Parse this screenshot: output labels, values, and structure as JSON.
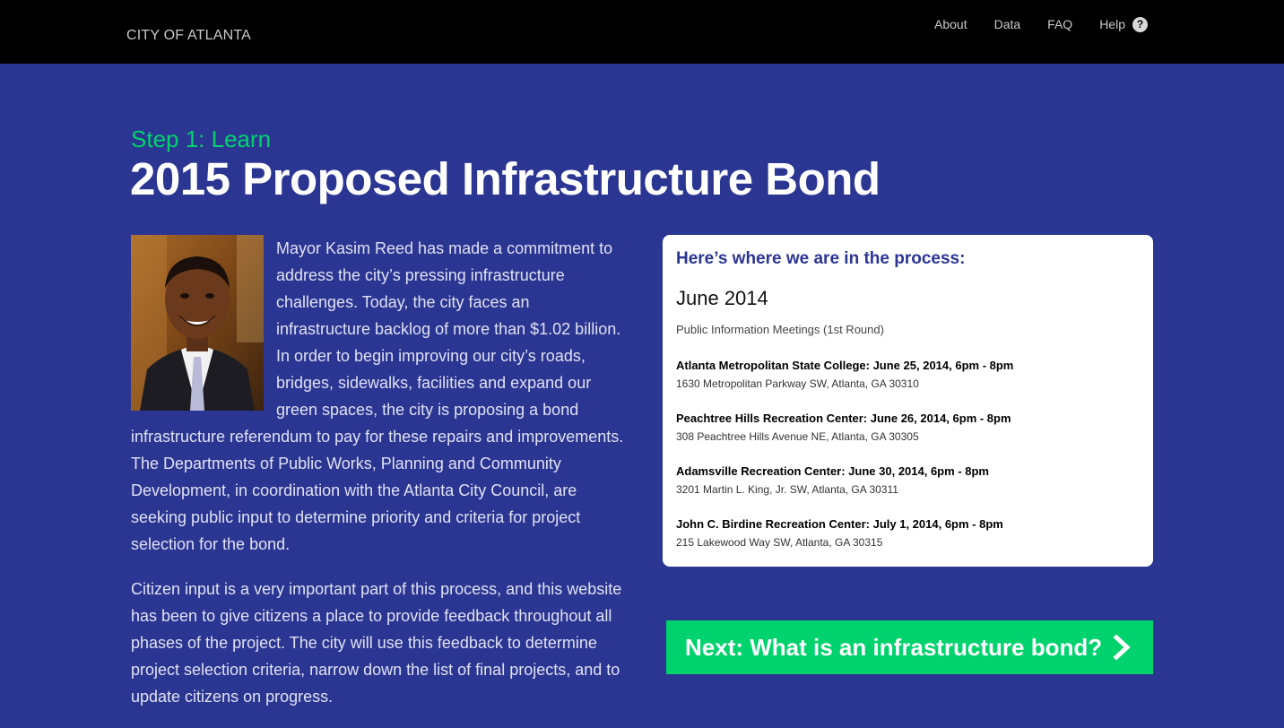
{
  "header": {
    "brand": "CITY OF ATLANTA",
    "nav": [
      {
        "label": "About"
      },
      {
        "label": "Data"
      },
      {
        "label": "FAQ"
      },
      {
        "label": "Help"
      }
    ],
    "help_icon_glyph": "?"
  },
  "hero": {
    "step": "Step 1: Learn",
    "title": "2015 Proposed Infrastructure Bond"
  },
  "intro": {
    "photo_alt": "Mayor Kasim Reed",
    "paragraphs": [
      "Mayor Kasim Reed has made a commitment to address the city’s pressing infrastructure challenges. Today, the city faces an infrastructure backlog of more than $1.02 billion. In order to begin improving our city’s roads, bridges, sidewalks, facilities and expand our green spaces, the city is proposing a bond infrastructure referendum to pay for these repairs and improvements. The Departments of Public Works, Planning and Community Development, in coordination with the Atlanta City Council, are seeking public input to determine priority and criteria for project selection for the bond.",
      "Citizen input is a very important part of this process, and this website has been to give citizens a place to provide feedback throughout all phases of the project. The city will use this feedback to determine project selection criteria, narrow down the list of final projects, and to update citizens on progress."
    ]
  },
  "process_card": {
    "heading": "Here’s where we are in the process:",
    "month": "June 2014",
    "subtitle": "Public Information Meetings (1st Round)",
    "events": [
      {
        "name": "Atlanta Metropolitan State College: June 25, 2014, 6pm - 8pm",
        "address": "1630 Metropolitan Parkway SW, Atlanta, GA 30310"
      },
      {
        "name": "Peachtree Hills Recreation Center: June 26, 2014, 6pm - 8pm",
        "address": "308 Peachtree Hills Avenue NE, Atlanta, GA 30305"
      },
      {
        "name": "Adamsville Recreation Center: June 30, 2014, 6pm - 8pm",
        "address": "3201 Martin L. King, Jr. SW, Atlanta, GA 30311"
      },
      {
        "name": "John C. Birdine Recreation Center: July 1, 2014, 6pm - 8pm",
        "address": "215 Lakewood Way SW, Atlanta, GA 30315"
      }
    ]
  },
  "next_button": {
    "label": "Next: What is an infrastructure bond?",
    "icon": "chevron-right-icon"
  },
  "colors": {
    "page_background": "#2b3592",
    "topbar": "#000000",
    "accent_green": "#00d36d",
    "card_heading": "#2b3592"
  }
}
